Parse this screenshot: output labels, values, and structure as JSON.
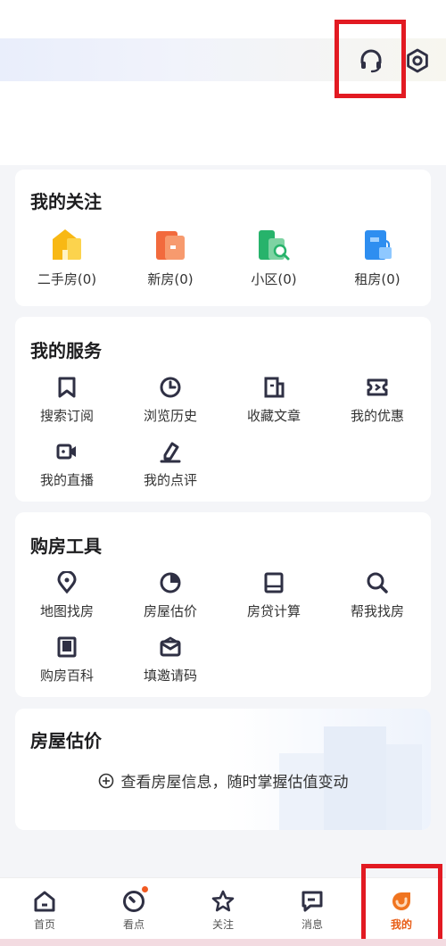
{
  "follow": {
    "title": "我的关注",
    "items": [
      {
        "label": "二手房(0)",
        "icon": "second-hand-house-icon",
        "color": "#f8b814"
      },
      {
        "label": "新房(0)",
        "icon": "new-house-icon",
        "color": "#f26a3d"
      },
      {
        "label": "小区(0)",
        "icon": "community-icon",
        "color": "#27b36b"
      },
      {
        "label": "租房(0)",
        "icon": "rental-icon",
        "color": "#2e8ef0"
      }
    ]
  },
  "services": {
    "title": "我的服务",
    "items": [
      {
        "label": "搜索订阅",
        "icon": "bookmark-icon"
      },
      {
        "label": "浏览历史",
        "icon": "clock-icon"
      },
      {
        "label": "收藏文章",
        "icon": "article-icon"
      },
      {
        "label": "我的优惠",
        "icon": "ticket-icon"
      },
      {
        "label": "我的直播",
        "icon": "video-icon"
      },
      {
        "label": "我的点评",
        "icon": "pen-icon"
      }
    ]
  },
  "tools": {
    "title": "购房工具",
    "items": [
      {
        "label": "地图找房",
        "icon": "map-pin-icon"
      },
      {
        "label": "房屋估价",
        "icon": "pie-icon"
      },
      {
        "label": "房贷计算",
        "icon": "calculator-icon"
      },
      {
        "label": "帮我找房",
        "icon": "search-icon"
      },
      {
        "label": "购房百科",
        "icon": "book-icon"
      },
      {
        "label": "填邀请码",
        "icon": "envelope-icon"
      }
    ]
  },
  "estimate": {
    "title": "房屋估价",
    "action": "查看房屋信息，随时掌握估值变动"
  },
  "tabbar": {
    "items": [
      {
        "label": "首页",
        "icon": "home-icon"
      },
      {
        "label": "看点",
        "icon": "discover-icon"
      },
      {
        "label": "关注",
        "icon": "star-icon"
      },
      {
        "label": "消息",
        "icon": "message-icon"
      },
      {
        "label": "我的",
        "icon": "profile-icon"
      }
    ],
    "active_color": "#e85b14"
  },
  "colors": {
    "accent": "#e85b14",
    "highlight_box": "#e21a22",
    "icon_dark": "#2f3044"
  }
}
